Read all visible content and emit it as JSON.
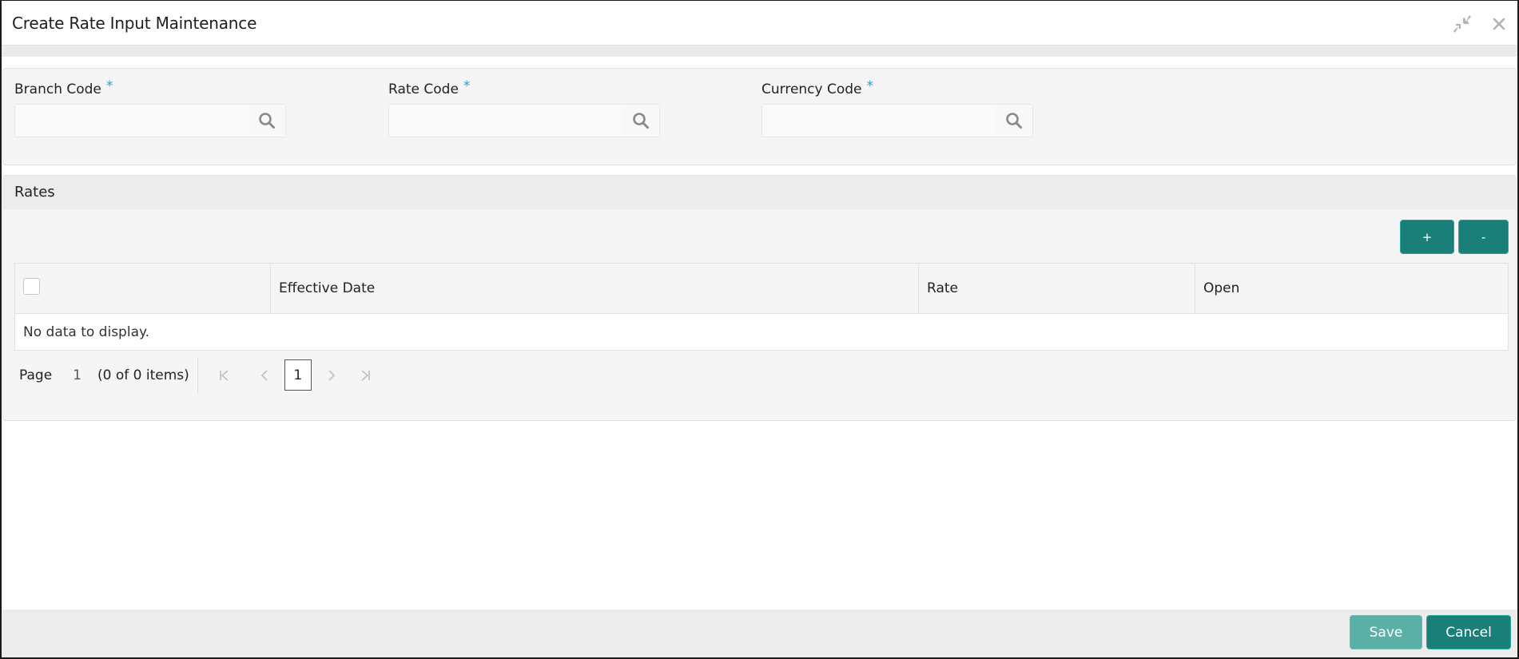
{
  "window": {
    "title": "Create Rate Input Maintenance",
    "icons": {
      "minimize": "minimize-arrows-icon",
      "close": "close-icon"
    }
  },
  "form": {
    "fields": [
      {
        "label": "Branch Code",
        "required": "*",
        "value": "",
        "placeholder": "",
        "icon": "search-icon"
      },
      {
        "label": "Rate Code",
        "required": "*",
        "value": "",
        "placeholder": "",
        "icon": "search-icon"
      },
      {
        "label": "Currency Code",
        "required": "*",
        "value": "",
        "placeholder": "",
        "icon": "search-icon"
      }
    ]
  },
  "rates": {
    "title": "Rates",
    "add_label": "+",
    "remove_label": "-",
    "columns": [
      "",
      "Effective Date",
      "Rate",
      "Open"
    ],
    "rows": [],
    "empty_message": "No data to display.",
    "pagination": {
      "page_label": "Page",
      "current_page": "1",
      "items_summary": "(0 of 0 items)",
      "pages": [
        "1"
      ]
    }
  },
  "footer": {
    "save_label": "Save",
    "cancel_label": "Cancel"
  },
  "colors": {
    "primary": "#1b7f79",
    "primary_disabled": "#5aafa6",
    "required": "#1fa0d8",
    "icon_gray": "#b5b2ac"
  }
}
